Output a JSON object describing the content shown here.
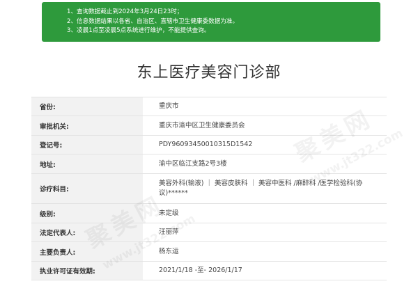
{
  "notice": {
    "lines": [
      "1、查询数据截止到2024年3月24日23时；",
      "2、信息数据结果以各省、自治区、直辖市卫生健康委数据为准。",
      "3、凌晨1点至凌晨5点系统进行维护，不能提供查询。"
    ]
  },
  "page_title": "东上医疗美容门诊部",
  "details": [
    {
      "label": "省份:",
      "value": "重庆市"
    },
    {
      "label": "审批机关:",
      "value": "重庆市渝中区卫生健康委员会"
    },
    {
      "label": "登记号:",
      "value": "PDY96093450010315D1542"
    },
    {
      "label": "地址:",
      "value": "渝中区临江支路2号3楼"
    },
    {
      "label": "诊疗科目:",
      "value": "美容外科(输液) ｜ 美容皮肤科 ｜ 美容中医科 /麻醉科 /医学检验科(协议)******"
    },
    {
      "label": "级别:",
      "value": "未定级"
    },
    {
      "label": "法定代表人:",
      "value": "汪丽萍"
    },
    {
      "label": "主要负责人:",
      "value": "杨东运"
    },
    {
      "label": "执业许可证有效期:",
      "value": "2021/1/18 -至- 2026/1/17"
    }
  ],
  "watermark": {
    "brand": "聚美网",
    "url": "www.jt322.com"
  },
  "colors": {
    "notice_bg": "#2e9a3c",
    "label_bg": "#f2f2f2"
  }
}
